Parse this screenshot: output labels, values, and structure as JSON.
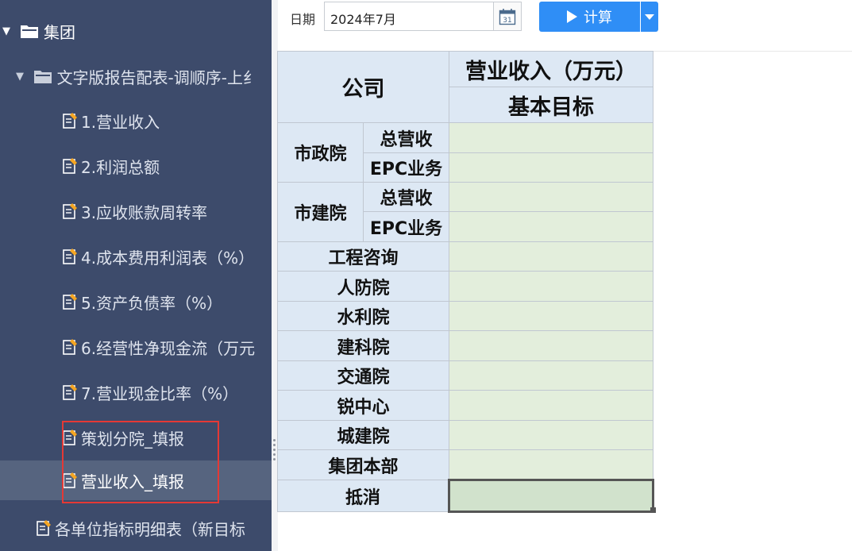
{
  "sidebar": {
    "root": {
      "label": "集团"
    },
    "folder": {
      "label": "文字版报告配表-调顺序-上纟"
    },
    "reports": [
      {
        "label": "1.营业收入"
      },
      {
        "label": "2.利润总额"
      },
      {
        "label": "3.应收账款周转率"
      },
      {
        "label": "4.成本费用利润表（%）"
      },
      {
        "label": "5.资产负债率（%）"
      },
      {
        "label": "6.经营性净现金流（万元"
      },
      {
        "label": "7.营业现金比率（%）"
      },
      {
        "label": "策划分院_填报"
      },
      {
        "label": "营业收入_填报",
        "selected": true
      }
    ],
    "bottom_item": {
      "label": "各单位指标明细表（新目标"
    }
  },
  "toolbar": {
    "date_label": "日期",
    "date_value": "2024年7月",
    "calendar_day": "31",
    "calc_label": "计算"
  },
  "table": {
    "header_company": "公司",
    "header_revenue": "营业收入（万元）",
    "header_target": "基本目标",
    "groups": [
      {
        "name": "市政院",
        "subs": [
          "总营收",
          "EPC业务"
        ]
      },
      {
        "name": "市建院",
        "subs": [
          "总营收",
          "EPC业务"
        ]
      }
    ],
    "rows": [
      "工程咨询",
      "人防院",
      "水利院",
      "建科院",
      "交通院",
      "锐中心",
      "城建院",
      "集团本部",
      "抵消"
    ]
  },
  "colors": {
    "sidebar_bg": "#3d4b6b",
    "selected_bg": "#56647f",
    "accent_button": "#2f8ef6",
    "header_cell": "#dde8f4",
    "input_cell": "#e3eedc",
    "highlight_box": "#e53935"
  }
}
